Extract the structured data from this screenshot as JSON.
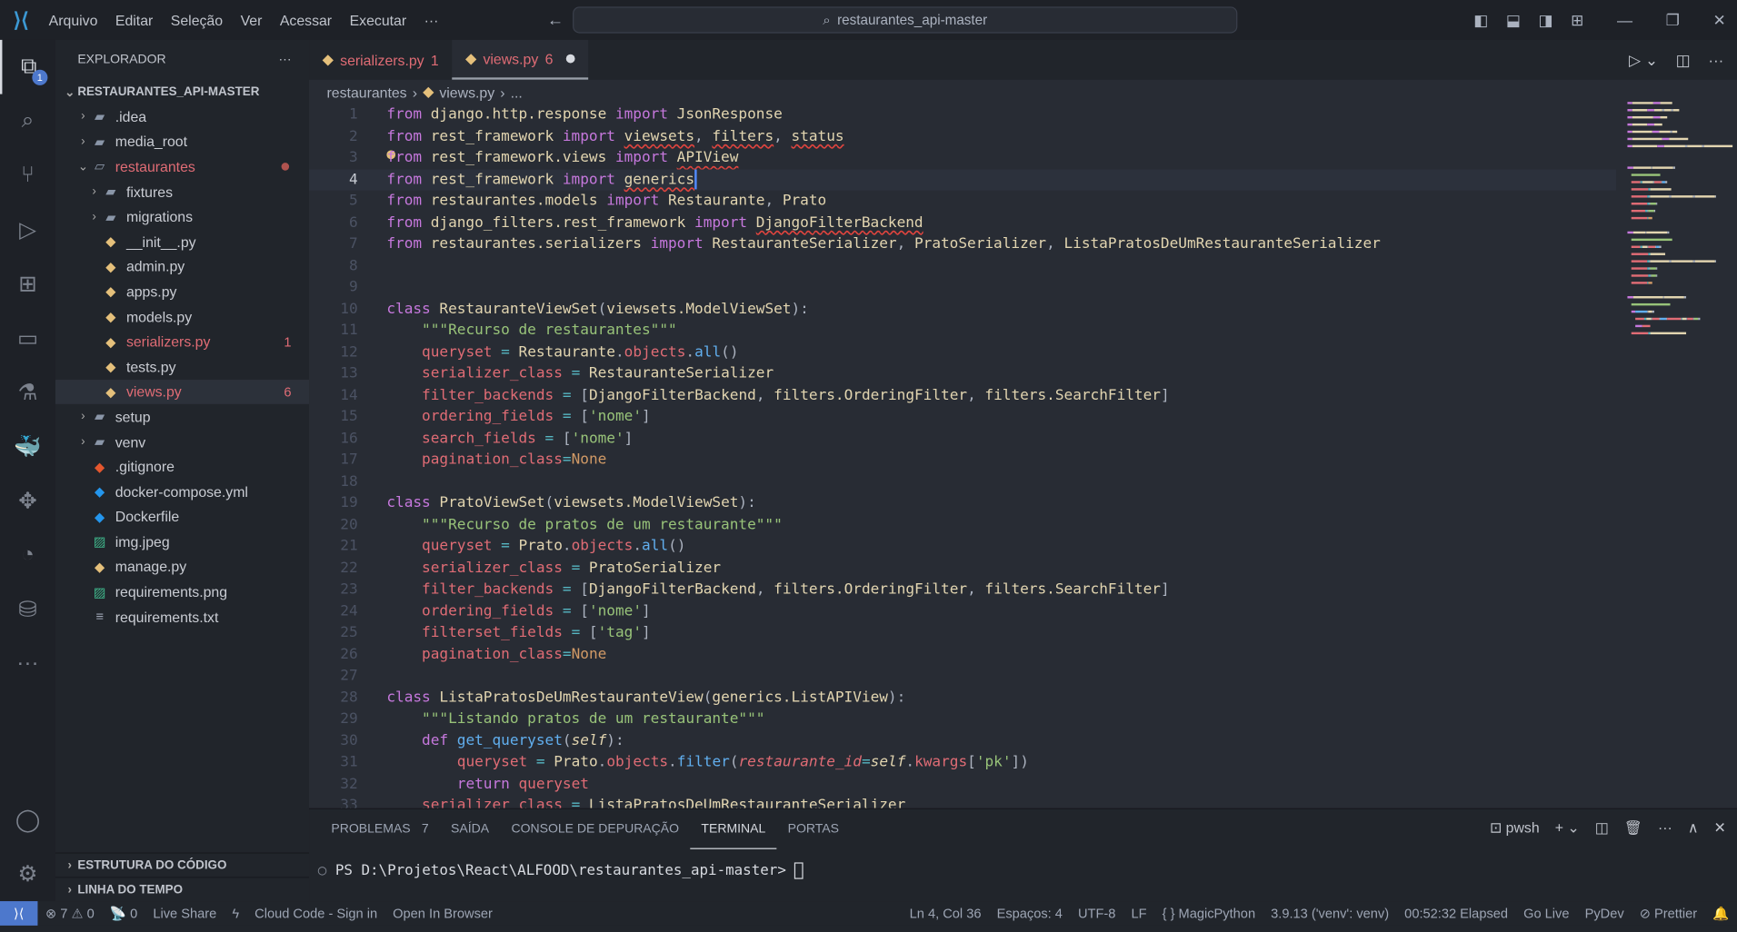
{
  "titlebar": {
    "menus": [
      "Arquivo",
      "Editar",
      "Seleção",
      "Ver",
      "Acessar",
      "Executar",
      "···"
    ],
    "search": "restaurantes_api-master"
  },
  "activity": {
    "explorer_badge": "1"
  },
  "sidebar": {
    "title": "EXPLORADOR",
    "more": "···",
    "project": "RESTAURANTES_API-MASTER",
    "items": [
      {
        "label": ".idea",
        "depth": 1,
        "type": "folder",
        "chev": "›"
      },
      {
        "label": "media_root",
        "depth": 1,
        "type": "folder",
        "chev": "›"
      },
      {
        "label": "restaurantes",
        "depth": 1,
        "type": "folder-open",
        "chev": "⌄",
        "err": true,
        "dot": true
      },
      {
        "label": "fixtures",
        "depth": 2,
        "type": "folder",
        "chev": "›"
      },
      {
        "label": "migrations",
        "depth": 2,
        "type": "folder",
        "chev": "›"
      },
      {
        "label": "__init__.py",
        "depth": 2,
        "type": "py"
      },
      {
        "label": "admin.py",
        "depth": 2,
        "type": "py"
      },
      {
        "label": "apps.py",
        "depth": 2,
        "type": "py"
      },
      {
        "label": "models.py",
        "depth": 2,
        "type": "py"
      },
      {
        "label": "serializers.py",
        "depth": 2,
        "type": "py",
        "err": true,
        "count": "1"
      },
      {
        "label": "tests.py",
        "depth": 2,
        "type": "py"
      },
      {
        "label": "views.py",
        "depth": 2,
        "type": "py",
        "err": true,
        "count": "6",
        "selected": true
      },
      {
        "label": "setup",
        "depth": 1,
        "type": "folder",
        "chev": "›"
      },
      {
        "label": "venv",
        "depth": 1,
        "type": "folder",
        "chev": "›"
      },
      {
        "label": ".gitignore",
        "depth": 1,
        "type": "git"
      },
      {
        "label": "docker-compose.yml",
        "depth": 1,
        "type": "docker"
      },
      {
        "label": "Dockerfile",
        "depth": 1,
        "type": "docker"
      },
      {
        "label": "img.jpeg",
        "depth": 1,
        "type": "image"
      },
      {
        "label": "manage.py",
        "depth": 1,
        "type": "py"
      },
      {
        "label": "requirements.png",
        "depth": 1,
        "type": "image"
      },
      {
        "label": "requirements.txt",
        "depth": 1,
        "type": "text"
      }
    ],
    "sections": [
      "ESTRUTURA DO CÓDIGO",
      "LINHA DO TEMPO"
    ]
  },
  "tabs": [
    {
      "label": "serializers.py",
      "count": "1"
    },
    {
      "label": "views.py",
      "count": "6",
      "active": true,
      "modified": true
    }
  ],
  "breadcrumb": [
    "restaurantes",
    "views.py",
    "..."
  ],
  "cursor_line": 4,
  "code": [
    [
      [
        "k",
        "from "
      ],
      [
        "n",
        "django.http.response "
      ],
      [
        "k",
        "import "
      ],
      [
        "n",
        "JsonResponse"
      ]
    ],
    [
      [
        "k",
        "from "
      ],
      [
        "n",
        "rest_framework "
      ],
      [
        "k",
        "import "
      ],
      [
        "n sq",
        "viewsets"
      ],
      [
        "p",
        ", "
      ],
      [
        "n sq",
        "filters"
      ],
      [
        "p",
        ", "
      ],
      [
        "n sq",
        "status"
      ]
    ],
    [
      [
        "k",
        "from "
      ],
      [
        "n",
        "rest_framework.views "
      ],
      [
        "k",
        "import "
      ],
      [
        "n sq",
        "APIView"
      ]
    ],
    [
      [
        "k",
        "from "
      ],
      [
        "n",
        "rest_framework "
      ],
      [
        "k",
        "import "
      ],
      [
        "n sq",
        "generics"
      ]
    ],
    [
      [
        "k",
        "from "
      ],
      [
        "n",
        "restaurantes.models "
      ],
      [
        "k",
        "import "
      ],
      [
        "n",
        "Restaurante"
      ],
      [
        "p",
        ", "
      ],
      [
        "n",
        "Prato"
      ]
    ],
    [
      [
        "k",
        "from "
      ],
      [
        "n",
        "django_filters.rest_framework "
      ],
      [
        "k",
        "import "
      ],
      [
        "n sq",
        "DjangoFilterBackend"
      ]
    ],
    [
      [
        "k",
        "from "
      ],
      [
        "n",
        "restaurantes.serializers "
      ],
      [
        "k",
        "import "
      ],
      [
        "n",
        "RestauranteSerializer"
      ],
      [
        "p",
        ", "
      ],
      [
        "n",
        "PratoSerializer"
      ],
      [
        "p",
        ", "
      ],
      [
        "n",
        "ListaPratosDeUmRestauranteSerializer"
      ]
    ],
    [],
    [],
    [
      [
        "k",
        "class "
      ],
      [
        "n",
        "RestauranteViewSet"
      ],
      [
        "p",
        "("
      ],
      [
        "n",
        "viewsets.ModelViewSet"
      ],
      [
        "p",
        "):"
      ]
    ],
    [
      [
        "p",
        "    "
      ],
      [
        "s",
        "\"\"\"Recurso de restaurantes\"\"\""
      ]
    ],
    [
      [
        "p",
        "    "
      ],
      [
        "v",
        "queryset "
      ],
      [
        "o",
        "= "
      ],
      [
        "n",
        "Restaurante"
      ],
      [
        "p",
        "."
      ],
      [
        "v",
        "objects"
      ],
      [
        "p",
        "."
      ],
      [
        "f",
        "all"
      ],
      [
        "p",
        "()"
      ]
    ],
    [
      [
        "p",
        "    "
      ],
      [
        "v",
        "serializer_class "
      ],
      [
        "o",
        "= "
      ],
      [
        "n",
        "RestauranteSerializer"
      ]
    ],
    [
      [
        "p",
        "    "
      ],
      [
        "v",
        "filter_backends "
      ],
      [
        "o",
        "= "
      ],
      [
        "p",
        "["
      ],
      [
        "n",
        "DjangoFilterBackend"
      ],
      [
        "p",
        ", "
      ],
      [
        "n",
        "filters.OrderingFilter"
      ],
      [
        "p",
        ", "
      ],
      [
        "n",
        "filters.SearchFilter"
      ],
      [
        "p",
        "]"
      ]
    ],
    [
      [
        "p",
        "    "
      ],
      [
        "v",
        "ordering_fields "
      ],
      [
        "o",
        "= "
      ],
      [
        "p",
        "["
      ],
      [
        "s",
        "'nome'"
      ],
      [
        "p",
        "]"
      ]
    ],
    [
      [
        "p",
        "    "
      ],
      [
        "v",
        "search_fields "
      ],
      [
        "o",
        "= "
      ],
      [
        "p",
        "["
      ],
      [
        "s",
        "'nome'"
      ],
      [
        "p",
        "]"
      ]
    ],
    [
      [
        "p",
        "    "
      ],
      [
        "v",
        "pagination_class"
      ],
      [
        "o",
        "="
      ],
      [
        "c",
        "None"
      ]
    ],
    [],
    [
      [
        "k",
        "class "
      ],
      [
        "n",
        "PratoViewSet"
      ],
      [
        "p",
        "("
      ],
      [
        "n",
        "viewsets.ModelViewSet"
      ],
      [
        "p",
        "):"
      ]
    ],
    [
      [
        "p",
        "    "
      ],
      [
        "s",
        "\"\"\"Recurso de pratos de um restaurante\"\"\""
      ]
    ],
    [
      [
        "p",
        "    "
      ],
      [
        "v",
        "queryset "
      ],
      [
        "o",
        "= "
      ],
      [
        "n",
        "Prato"
      ],
      [
        "p",
        "."
      ],
      [
        "v",
        "objects"
      ],
      [
        "p",
        "."
      ],
      [
        "f",
        "all"
      ],
      [
        "p",
        "()"
      ]
    ],
    [
      [
        "p",
        "    "
      ],
      [
        "v",
        "serializer_class "
      ],
      [
        "o",
        "= "
      ],
      [
        "n",
        "PratoSerializer"
      ]
    ],
    [
      [
        "p",
        "    "
      ],
      [
        "v",
        "filter_backends "
      ],
      [
        "o",
        "= "
      ],
      [
        "p",
        "["
      ],
      [
        "n",
        "DjangoFilterBackend"
      ],
      [
        "p",
        ", "
      ],
      [
        "n",
        "filters.OrderingFilter"
      ],
      [
        "p",
        ", "
      ],
      [
        "n",
        "filters.SearchFilter"
      ],
      [
        "p",
        "]"
      ]
    ],
    [
      [
        "p",
        "    "
      ],
      [
        "v",
        "ordering_fields "
      ],
      [
        "o",
        "= "
      ],
      [
        "p",
        "["
      ],
      [
        "s",
        "'nome'"
      ],
      [
        "p",
        "]"
      ]
    ],
    [
      [
        "p",
        "    "
      ],
      [
        "v",
        "filterset_fields "
      ],
      [
        "o",
        "= "
      ],
      [
        "p",
        "["
      ],
      [
        "s",
        "'tag'"
      ],
      [
        "p",
        "]"
      ]
    ],
    [
      [
        "p",
        "    "
      ],
      [
        "v",
        "pagination_class"
      ],
      [
        "o",
        "="
      ],
      [
        "c",
        "None"
      ]
    ],
    [],
    [
      [
        "k",
        "class "
      ],
      [
        "n",
        "ListaPratosDeUmRestauranteView"
      ],
      [
        "p",
        "("
      ],
      [
        "n",
        "generics.ListAPIView"
      ],
      [
        "p",
        "):"
      ]
    ],
    [
      [
        "p",
        "    "
      ],
      [
        "s",
        "\"\"\"Listando pratos de um restaurante\"\"\""
      ]
    ],
    [
      [
        "p",
        "    "
      ],
      [
        "k",
        "def "
      ],
      [
        "f",
        "get_queryset"
      ],
      [
        "p",
        "("
      ],
      [
        "sf",
        "self"
      ],
      [
        "p",
        "):"
      ]
    ],
    [
      [
        "p",
        "        "
      ],
      [
        "v",
        "queryset "
      ],
      [
        "o",
        "= "
      ],
      [
        "n",
        "Prato"
      ],
      [
        "p",
        "."
      ],
      [
        "v",
        "objects"
      ],
      [
        "p",
        "."
      ],
      [
        "f",
        "filter"
      ],
      [
        "p",
        "("
      ],
      [
        "i",
        "restaurante_id"
      ],
      [
        "o",
        "="
      ],
      [
        "sf",
        "self"
      ],
      [
        "p",
        "."
      ],
      [
        "v",
        "kwargs"
      ],
      [
        "p",
        "["
      ],
      [
        "s",
        "'pk'"
      ],
      [
        "p",
        "])"
      ]
    ],
    [
      [
        "p",
        "        "
      ],
      [
        "k",
        "return "
      ],
      [
        "v",
        "queryset"
      ]
    ],
    [
      [
        "p",
        "    "
      ],
      [
        "v",
        "serializer_class "
      ],
      [
        "o",
        "= "
      ],
      [
        "n",
        "ListaPratosDeUmRestauranteSerializer"
      ]
    ]
  ],
  "panel": {
    "tabs": [
      {
        "label": "PROBLEMAS",
        "count": "7"
      },
      {
        "label": "SAÍDA"
      },
      {
        "label": "CONSOLE DE DEPURAÇÃO"
      },
      {
        "label": "TERMINAL",
        "active": true
      },
      {
        "label": "PORTAS"
      }
    ],
    "shell": "pwsh",
    "prompt": "PS D:\\Projetos\\React\\ALFOOD\\restaurantes_api-master> "
  },
  "status": {
    "left": [
      "⊗ 7 ⚠ 0",
      "📡 0",
      "Live Share",
      "ϟ",
      "Cloud Code - Sign in",
      "Open In Browser"
    ],
    "right": [
      "Ln 4, Col 36",
      "Espaços: 4",
      "UTF-8",
      "LF",
      "{ } MagicPython",
      "3.9.13 ('venv': venv)",
      "00:52:32 Elapsed",
      "Go Live",
      "PyDev",
      "⊘ Prettier",
      "🔔"
    ]
  }
}
